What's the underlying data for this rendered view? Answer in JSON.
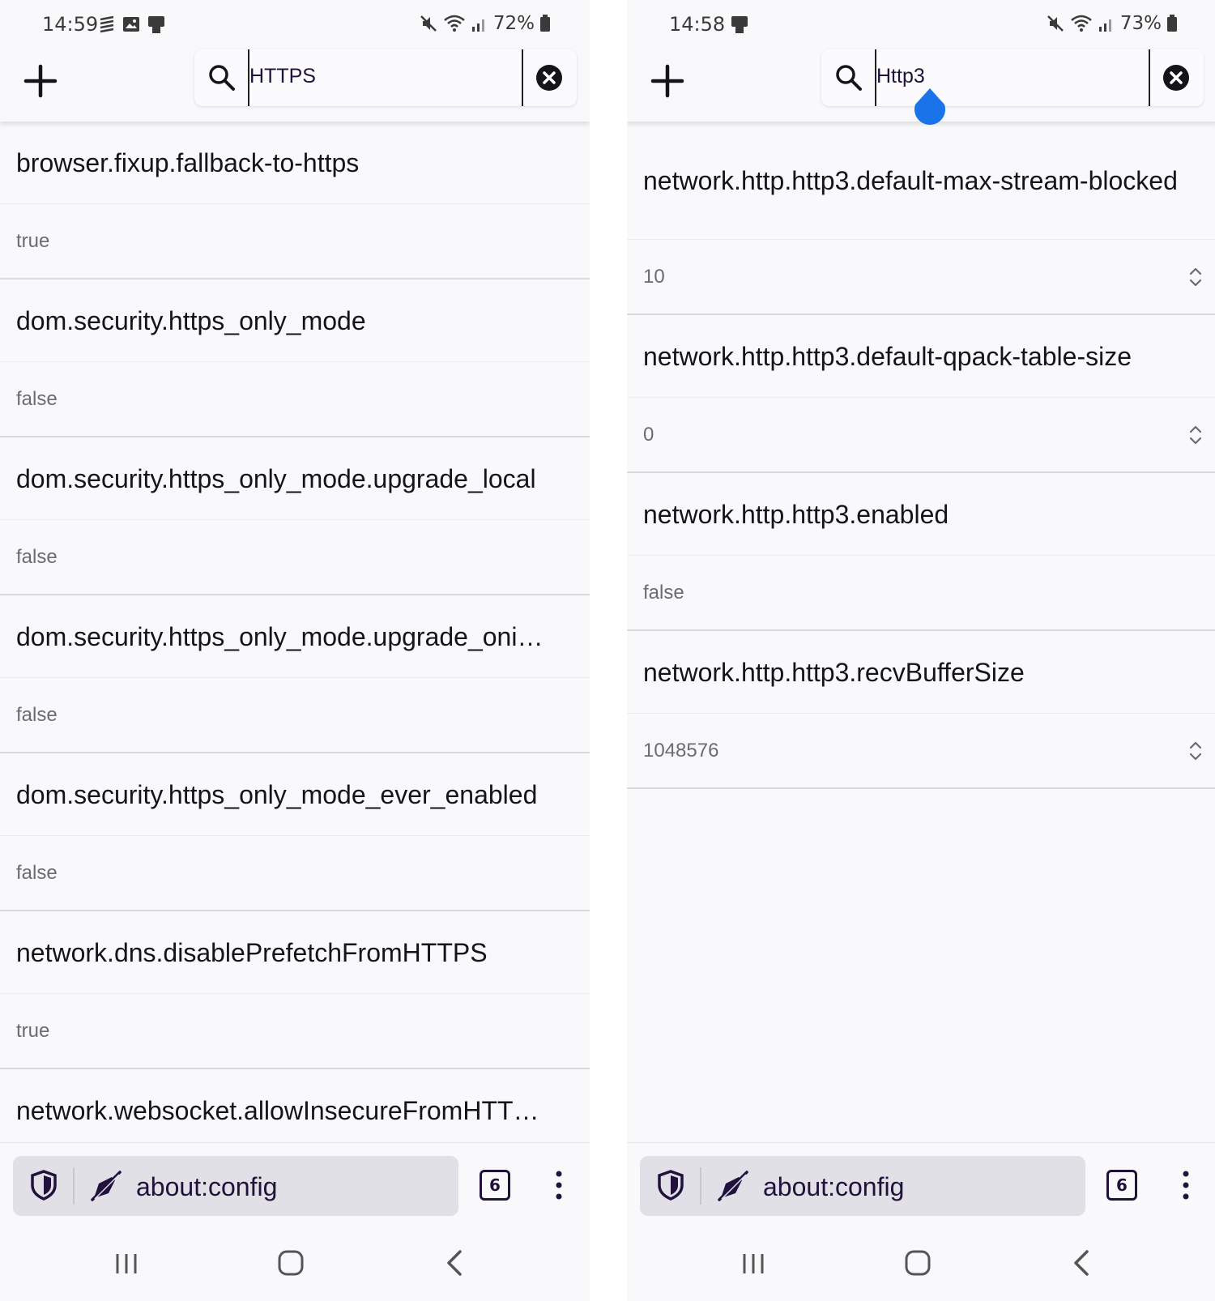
{
  "left": {
    "status": {
      "time": "14:59",
      "battery": "72%"
    },
    "search": {
      "value": "HTTPS"
    },
    "prefs": [
      {
        "name": "browser.fixup.fallback-to-https",
        "value": "true"
      },
      {
        "name": "dom.security.https_only_mode",
        "value": "false"
      },
      {
        "name": "dom.security.https_only_mode.upgrade_local",
        "value": "false"
      },
      {
        "name": "dom.security.https_only_mode.upgrade_oni…",
        "value": "false"
      },
      {
        "name": "dom.security.https_only_mode_ever_enabled",
        "value": "false"
      },
      {
        "name": "network.dns.disablePrefetchFromHTTPS",
        "value": "true"
      },
      {
        "name": "network.websocket.allowInsecureFromHTT…"
      }
    ],
    "url": "about:config",
    "tab_count": "6"
  },
  "right": {
    "status": {
      "time": "14:58",
      "battery": "73%"
    },
    "search": {
      "value": "Http3"
    },
    "prefs": [
      {
        "name": "network.http.http3.default-max-stream-blocked",
        "value": "10"
      },
      {
        "name": "network.http.http3.default-qpack-table-size",
        "value": "0"
      },
      {
        "name": "network.http.http3.enabled",
        "value": "false"
      },
      {
        "name": "network.http.http3.recvBufferSize",
        "value": "1048576"
      }
    ],
    "url": "about:config",
    "tab_count": "6"
  },
  "colors": {
    "background": "#f9f9fb",
    "text": "#15141a",
    "muted_text": "#6b6b70",
    "url_pill": "#e0e0e6",
    "cursor_handle": "#1a73e8"
  },
  "icons": [
    "add-icon",
    "search-icon",
    "clear-icon",
    "shield-icon",
    "insecure-connection-icon",
    "tab-counter-icon",
    "menu-icon",
    "recents-icon",
    "home-icon",
    "back-icon",
    "stepper-icon",
    "mute-icon",
    "wifi-icon",
    "signal-icon",
    "battery-icon"
  ]
}
